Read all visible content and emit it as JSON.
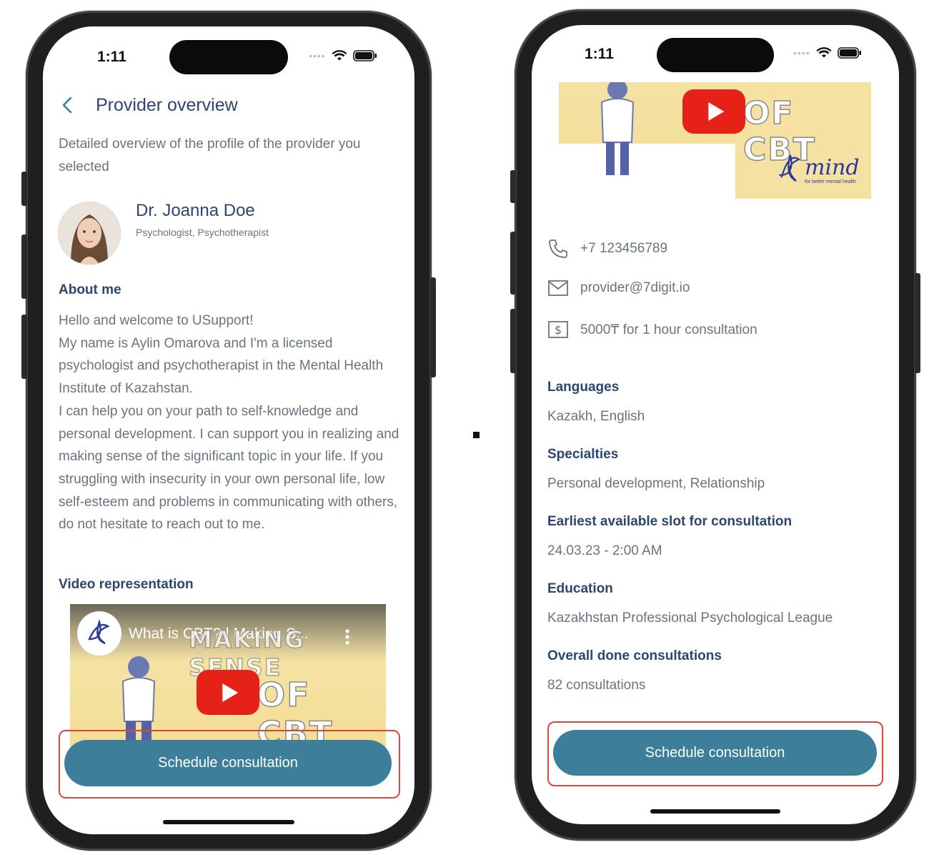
{
  "status_bar": {
    "time": "1:11"
  },
  "left": {
    "header": {
      "back_icon": "chevron-left-icon",
      "title": "Provider overview"
    },
    "subtitle": "Detailed overview of the profile of the provider you selected",
    "provider": {
      "name": "Dr. Joanna  Doe",
      "role": "Psychologist, Psychotherapist"
    },
    "about_heading": "About me",
    "about_text": "Hello and welcome to USupport!\nMy name is Aylin Omarova and I'm a licensed psychologist and psychotherapist in the Mental Health Institute of Kazahstan.\nI can help you on your path to self-knowledge and personal development. I can support you in realizing and making sense of the significant topic in your life. If you struggling with insecurity in your own personal life, low self-esteem and problems in communicating with others, do not hesitate to reach out to me.",
    "video_heading": "Video representation",
    "video": {
      "title": "What is CBT? | Making S...",
      "overlay_top": "MAKING SENSE",
      "overlay_bottom": "OF CBT"
    },
    "cta_label": "Schedule consultation"
  },
  "right": {
    "video": {
      "overlay_bottom": "OF CBT",
      "brand": "mind",
      "brand_tagline": "for better mental health"
    },
    "contacts": {
      "phone": "+7 123456789",
      "email": "provider@7digit.io",
      "price": "5000₸ for 1 hour consultation"
    },
    "languages": {
      "label": "Languages",
      "value": "Kazakh, English"
    },
    "specialties": {
      "label": "Specialties",
      "value": "Personal development, Relationship"
    },
    "earliest_slot": {
      "label": "Earliest available slot for consultation",
      "value": "24.03.23 - 2:00 AM"
    },
    "education": {
      "label": "Education",
      "value": "Kazakhstan Professional Psychological League"
    },
    "done_consultations": {
      "label": "Overall done consultations",
      "value": "82 consultations"
    },
    "cta_label": "Schedule consultation"
  },
  "colors": {
    "primary": "#3d7f9b",
    "heading": "#2c4670",
    "body": "#6b7380",
    "highlight": "#e0453a",
    "youtube": "#e62117"
  }
}
